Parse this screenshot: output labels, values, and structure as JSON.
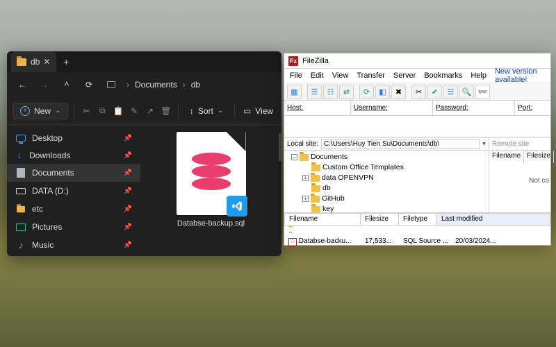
{
  "explorer": {
    "tab_title": "db",
    "breadcrumb": {
      "item1": "Documents",
      "item2": "db"
    },
    "new_label": "New",
    "sort_label": "Sort",
    "view_label": "View",
    "sidebar": {
      "items": [
        {
          "label": "Desktop"
        },
        {
          "label": "Downloads"
        },
        {
          "label": "Documents"
        },
        {
          "label": "DATA (D:)"
        },
        {
          "label": "etc"
        },
        {
          "label": "Pictures"
        },
        {
          "label": "Music"
        }
      ]
    },
    "file": {
      "name": "Databse-backup.sql"
    }
  },
  "filezilla": {
    "title": "FileZilla",
    "menu": {
      "file": "File",
      "edit": "Edit",
      "view": "View",
      "transfer": "Transfer",
      "server": "Server",
      "bookmarks": "Bookmarks",
      "help": "Help",
      "update": "New version available!"
    },
    "quick": {
      "host_label": "Host:",
      "user_label": "Username:",
      "pass_label": "Password:",
      "port_label": "Port:"
    },
    "local": {
      "label": "Local site:",
      "path": "C:\\Users\\Huy Tien Su\\Documents\\db\\",
      "tree": {
        "root": "Documents",
        "children": [
          "Custom Office Templates",
          "data OPENVPN",
          "db",
          "GitHub",
          "key"
        ]
      }
    },
    "remote": {
      "label": "Remote site",
      "col_filename": "Filename",
      "col_filesize": "Filesize",
      "empty": "Not co"
    },
    "list": {
      "headers": {
        "name": "Filename",
        "size": "Filesize",
        "type": "Filetype",
        "mod": "Last modified"
      },
      "rows": [
        {
          "name": "Databse-backu...",
          "size": "17,533...",
          "type": "SQL Source ...",
          "mod": "20/03/2024..."
        }
      ]
    }
  }
}
